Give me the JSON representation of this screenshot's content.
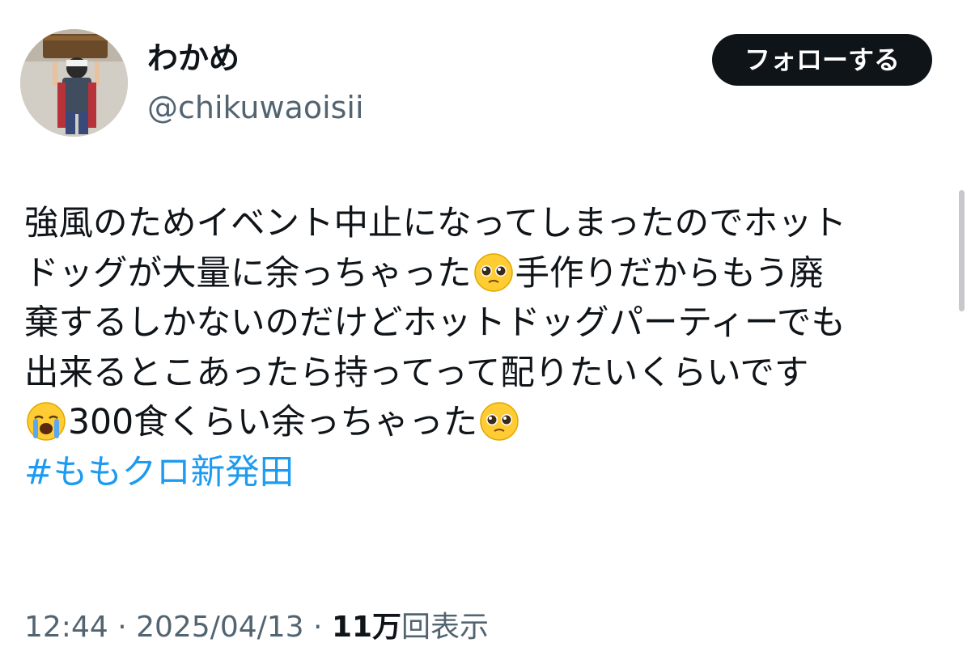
{
  "tweet": {
    "author": {
      "display_name": "わかめ",
      "handle": "@chikuwaoisii"
    },
    "follow_button_label": "フォローする",
    "text_lines": [
      {
        "before": "強風のためイベント中止になってしまったのでホット",
        "emoji": null,
        "after": ""
      },
      {
        "before": "ドッグが大量に余っちゃった",
        "emoji": "pleading-face",
        "after": "手作りだからもう廃"
      },
      {
        "before": "棄するしかないのだけどホットドッグパーティーでも",
        "emoji": null,
        "after": ""
      },
      {
        "before": "出来るとこあったら持ってって配りたいくらいです",
        "emoji": null,
        "after": ""
      },
      {
        "before": "",
        "emoji": "loudly-crying-face",
        "after": "300食くらい余っちゃった",
        "trailing_emoji": "pleading-face"
      }
    ],
    "hashtag": "#ももクロ新発田",
    "meta": {
      "time": "12:44",
      "separator": " · ",
      "date": "2025/04/13",
      "views_count": "11万",
      "views_label": "回表示"
    }
  },
  "colors": {
    "text": "#0f1419",
    "secondary": "#536471",
    "link": "#1d9bf0",
    "button_bg": "#0f1419",
    "button_text": "#ffffff"
  }
}
